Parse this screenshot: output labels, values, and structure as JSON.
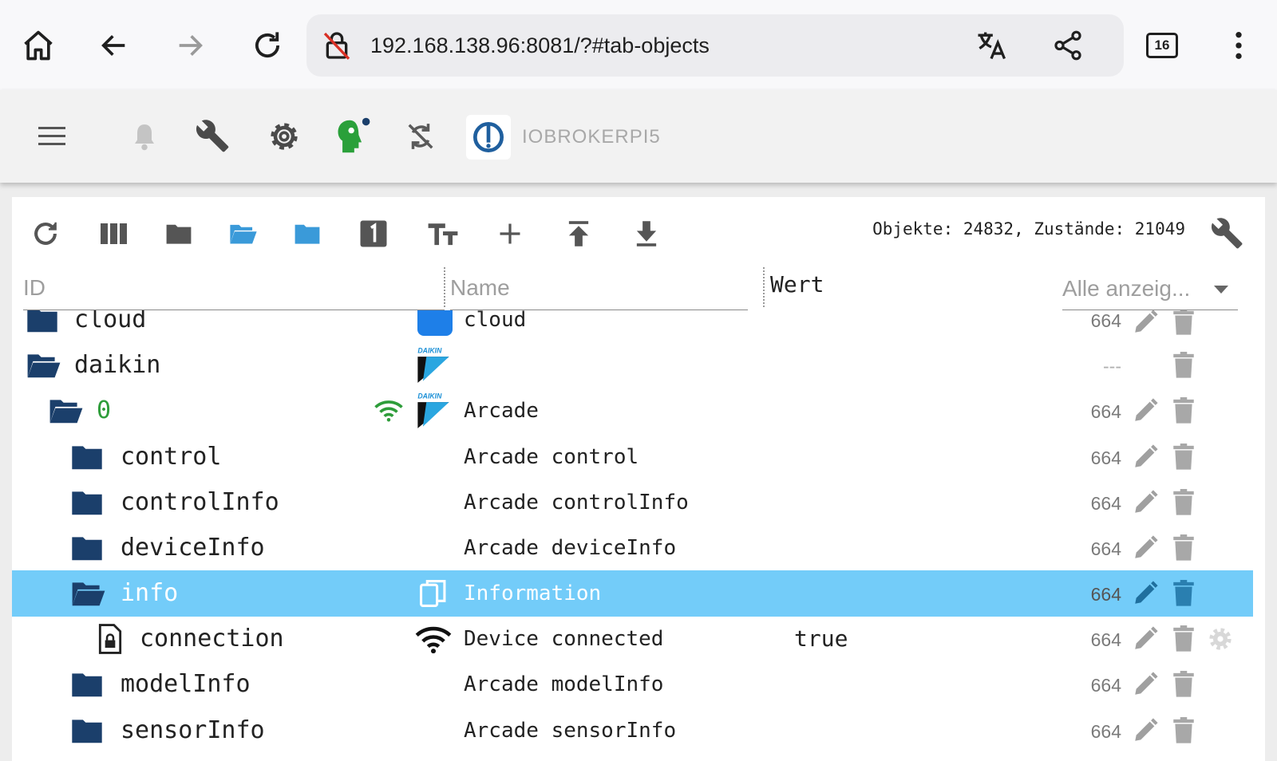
{
  "browser": {
    "url": "192.168.138.96:8081/?#tab-objects",
    "tab_count": "16",
    "icons": [
      "home-icon",
      "back-icon",
      "forward-icon",
      "reload-icon",
      "insecure-lock-icon",
      "translate-icon",
      "share-icon",
      "tabs-icon",
      "more-vert-icon"
    ]
  },
  "app": {
    "host_name": "IOBROKERPI5",
    "icons": [
      "menu-icon",
      "bell-icon",
      "wrench-icon",
      "gear-icon",
      "user-head-icon",
      "sync-disabled-icon",
      "iobroker-logo-icon"
    ]
  },
  "toolbar": {
    "stats": "Objekte: 24832, Zustände: 21049",
    "icons": [
      "refresh-icon",
      "columns-icon",
      "folder-icon",
      "folder-open-icon",
      "folder-blue-icon",
      "number-one-icon",
      "text-size-icon",
      "add-icon",
      "upload-icon",
      "download-icon",
      "wrench-icon"
    ]
  },
  "columns": {
    "id_placeholder": "ID",
    "name_placeholder": "Name",
    "value_header": "Wert",
    "filter_value": "Alle anzeig..."
  },
  "rows": [
    {
      "id": "cloud",
      "name": "cloud",
      "value": "",
      "acl": "664",
      "indent": 0
    },
    {
      "id": "daikin",
      "name": "",
      "value": "",
      "acl": "---",
      "indent": 0
    },
    {
      "id": "0",
      "name": "Arcade",
      "value": "",
      "acl": "664",
      "indent": 1
    },
    {
      "id": "control",
      "name": "Arcade control",
      "value": "",
      "acl": "664",
      "indent": 2
    },
    {
      "id": "controlInfo",
      "name": "Arcade controlInfo",
      "value": "",
      "acl": "664",
      "indent": 2
    },
    {
      "id": "deviceInfo",
      "name": "Arcade deviceInfo",
      "value": "",
      "acl": "664",
      "indent": 2
    },
    {
      "id": "info",
      "name": "Information",
      "value": "",
      "acl": "664",
      "indent": 2,
      "selected": true
    },
    {
      "id": "connection",
      "name": "Device connected",
      "value": "true",
      "acl": "664",
      "indent": 3
    },
    {
      "id": "modelInfo",
      "name": "Arcade modelInfo",
      "value": "",
      "acl": "664",
      "indent": 2
    },
    {
      "id": "sensorInfo",
      "name": "Arcade sensorInfo",
      "value": "",
      "acl": "664",
      "indent": 2
    }
  ],
  "colors": {
    "folder": "#1b3f6b",
    "selected_row": "#73ccf9",
    "online_green": "#2e9d3a",
    "muted_icon": "#9e9e9e"
  }
}
